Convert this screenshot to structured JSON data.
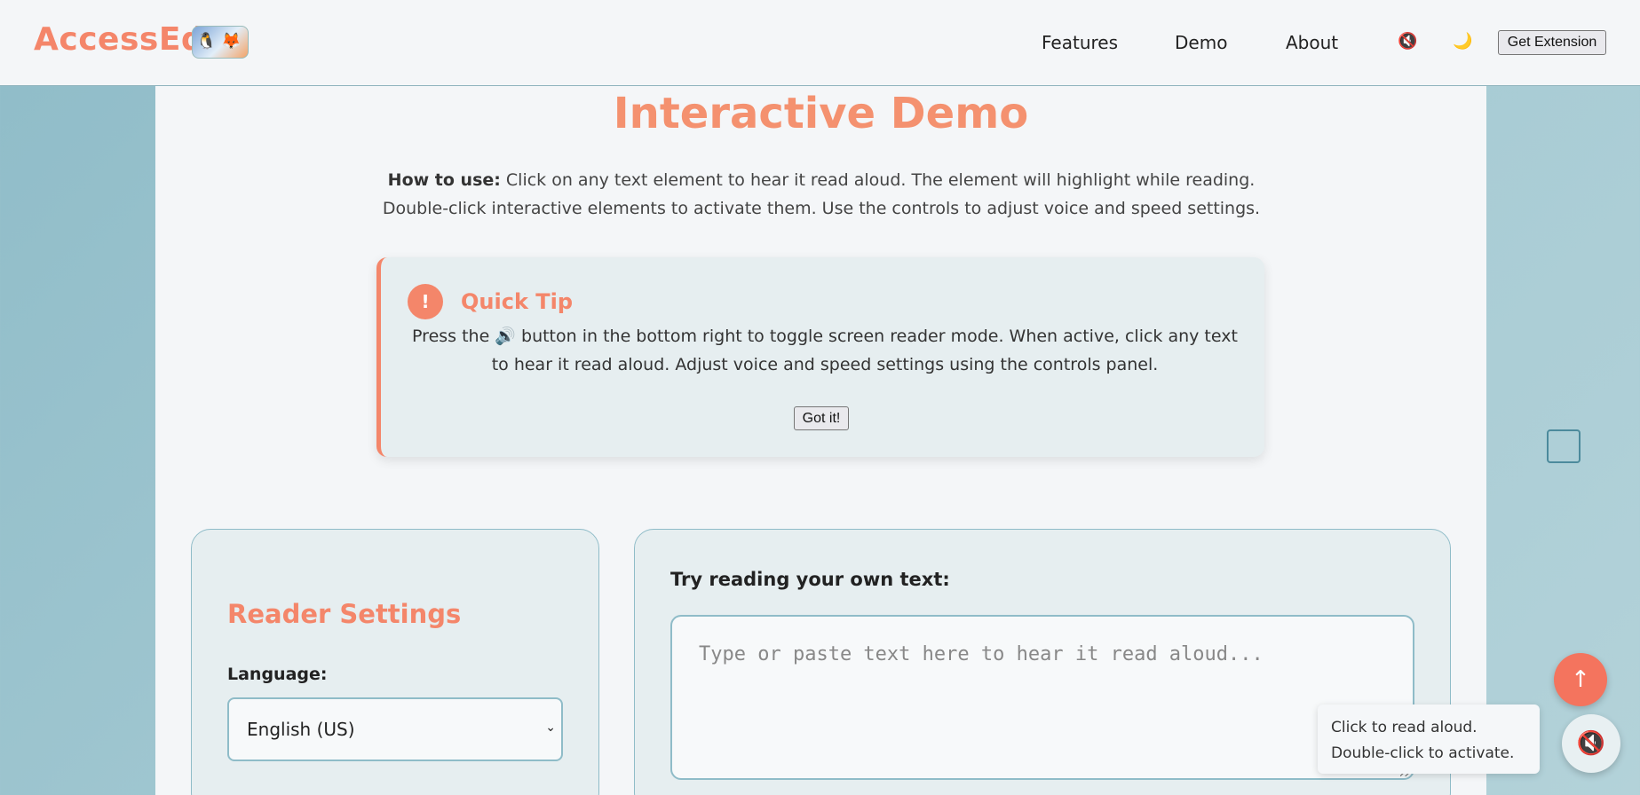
{
  "header": {
    "logo": "AccessEd",
    "nav": [
      "Features",
      "Demo",
      "About"
    ],
    "sound_icon": "🔇",
    "theme_icon": "🌙",
    "cta": "Get Extension"
  },
  "main": {
    "title": "Interactive Demo",
    "howto_label": "How to use:",
    "howto_text": " Click on any text element to hear it read aloud. The element will highlight while reading. Double-click interactive elements to activate them. Use the controls to adjust voice and speed settings."
  },
  "tip": {
    "badge": "!",
    "title": "Quick Tip",
    "body": "Press the 🔊 button in the bottom right to toggle screen reader mode. When active, click any text to hear it read aloud. Adjust voice and speed settings using the controls panel.",
    "button": "Got it!"
  },
  "settings": {
    "title": "Reader Settings",
    "language_label": "Language:",
    "language_value": "English (US)"
  },
  "reader": {
    "label": "Try reading your own text:",
    "placeholder": "Type or paste text here to hear it read aloud..."
  },
  "floating": {
    "scroll_top_icon": "↑",
    "toggle_icon": "🔇",
    "tooltip_line1": "Click to read aloud.",
    "tooltip_line2": "Double-click to activate."
  }
}
